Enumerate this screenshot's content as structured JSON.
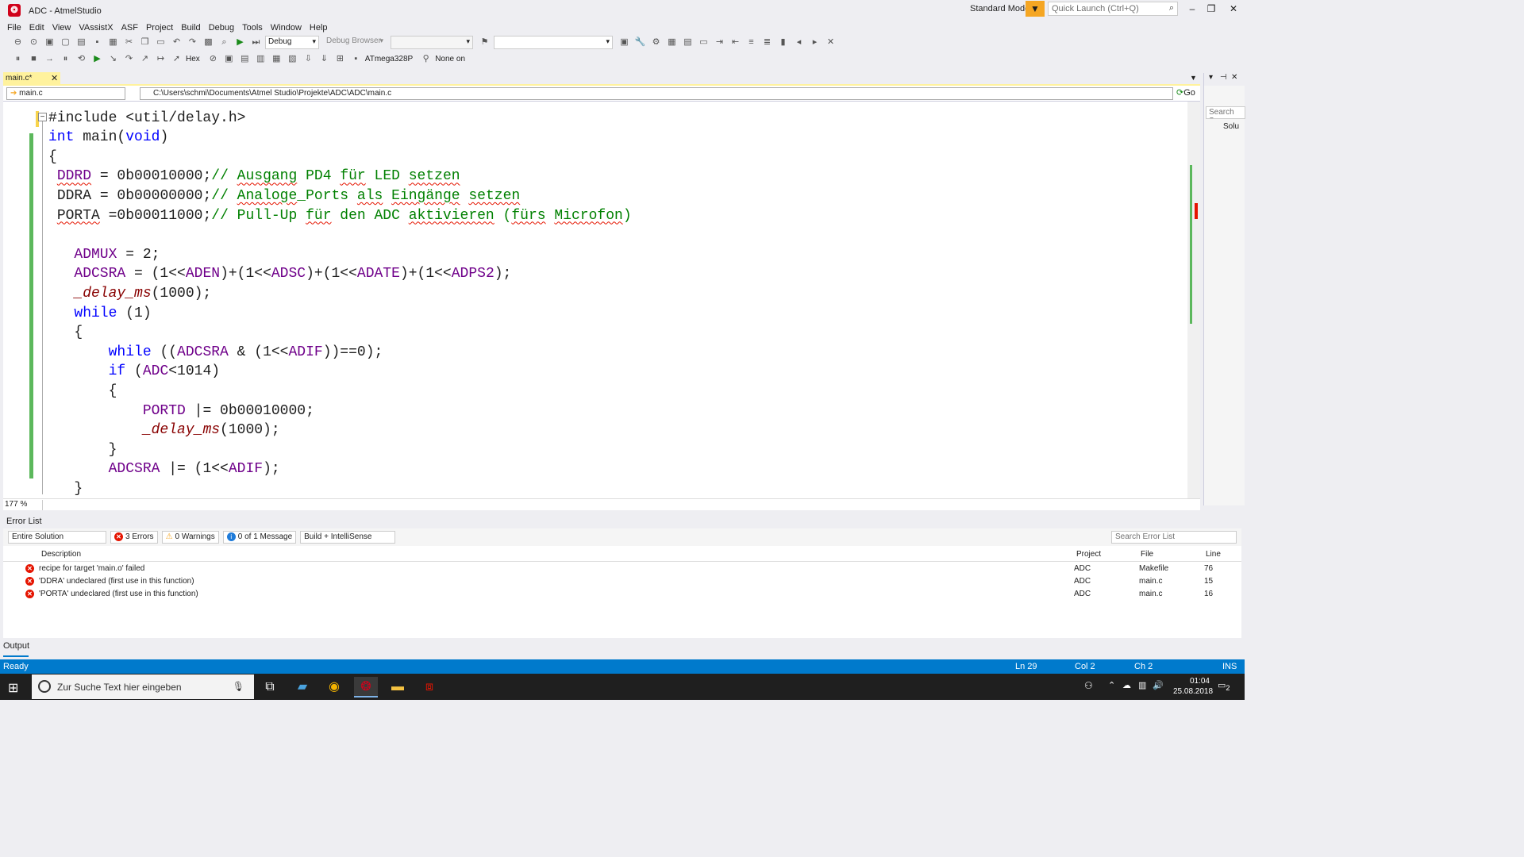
{
  "window": {
    "title": "ADC - AtmelStudio",
    "mode": "Standard Mode",
    "quick_launch_placeholder": "Quick Launch (Ctrl+Q)",
    "controls": [
      "–",
      "❐",
      "✕"
    ]
  },
  "menu": [
    "File",
    "Edit",
    "View",
    "VAssistX",
    "ASF",
    "Project",
    "Build",
    "Debug",
    "Tools",
    "Window",
    "Help"
  ],
  "toolbar": {
    "config": "Debug",
    "debug_browser": "Debug Browser",
    "hex_label": "Hex",
    "device": "ATmega328P",
    "tool": "None on"
  },
  "editor": {
    "tab_label": "main.c*",
    "nav_file": "main.c",
    "nav_path": "C:\\Users\\schmi\\Documents\\Atmel Studio\\Projekte\\ADC\\ADC\\main.c",
    "go_label": "Go",
    "zoom": "177 %",
    "lines": [
      "#include <util/delay.h>",
      "int main(void)",
      "{",
      " DDRD = 0b00010000;// Ausgang PD4 für LED setzen",
      " DDRA = 0b00000000;// Analoge_Ports als Eingänge setzen",
      " PORTA =0b00011000;// Pull-Up für den ADC aktivieren (fürs Microfon)",
      "",
      "   ADMUX = 2;",
      "   ADCSRA = (1<<ADEN)+(1<<ADSC)+(1<<ADATE)+(1<<ADPS2);",
      "   _delay_ms(1000);",
      "   while (1)",
      "   {",
      "       while ((ADCSRA & (1<<ADIF))==0);",
      "       if (ADC<1014)",
      "       {",
      "           PORTD |= 0b00010000;",
      "           _delay_ms(1000);",
      "       }",
      "       ADCSRA |= (1<<ADIF);",
      "   }",
      "}"
    ]
  },
  "right_panel": {
    "search": "Search So",
    "item": "Solu"
  },
  "error_list": {
    "title": "Error List",
    "scope": "Entire Solution",
    "errors_btn": "3 Errors",
    "warnings_btn": "0 Warnings",
    "messages_btn": "0 of 1 Message",
    "build_filter": "Build + IntelliSense",
    "search_placeholder": "Search Error List",
    "columns": [
      "Description",
      "Project",
      "File",
      "Line"
    ],
    "rows": [
      {
        "description": "recipe for target 'main.o' failed",
        "project": "ADC",
        "file": "Makefile",
        "line": "76"
      },
      {
        "description": "'DDRA' undeclared (first use in this function)",
        "project": "ADC",
        "file": "main.c",
        "line": "15"
      },
      {
        "description": "'PORTA' undeclared (first use in this function)",
        "project": "ADC",
        "file": "main.c",
        "line": "16"
      }
    ]
  },
  "output_tab": "Output",
  "status": {
    "left": "Ready",
    "ln": "Ln 29",
    "col": "Col 2",
    "ch": "Ch 2",
    "ins": "INS"
  },
  "taskbar": {
    "search_placeholder": "Zur Suche Text hier eingeben",
    "time": "01:04",
    "date": "25.08.2018",
    "notifications": "2"
  },
  "colors": {
    "accent": "#007acc",
    "keyword": "#0000ff",
    "comment": "#008000",
    "macro": "#6f008a",
    "error": "#e51400"
  }
}
